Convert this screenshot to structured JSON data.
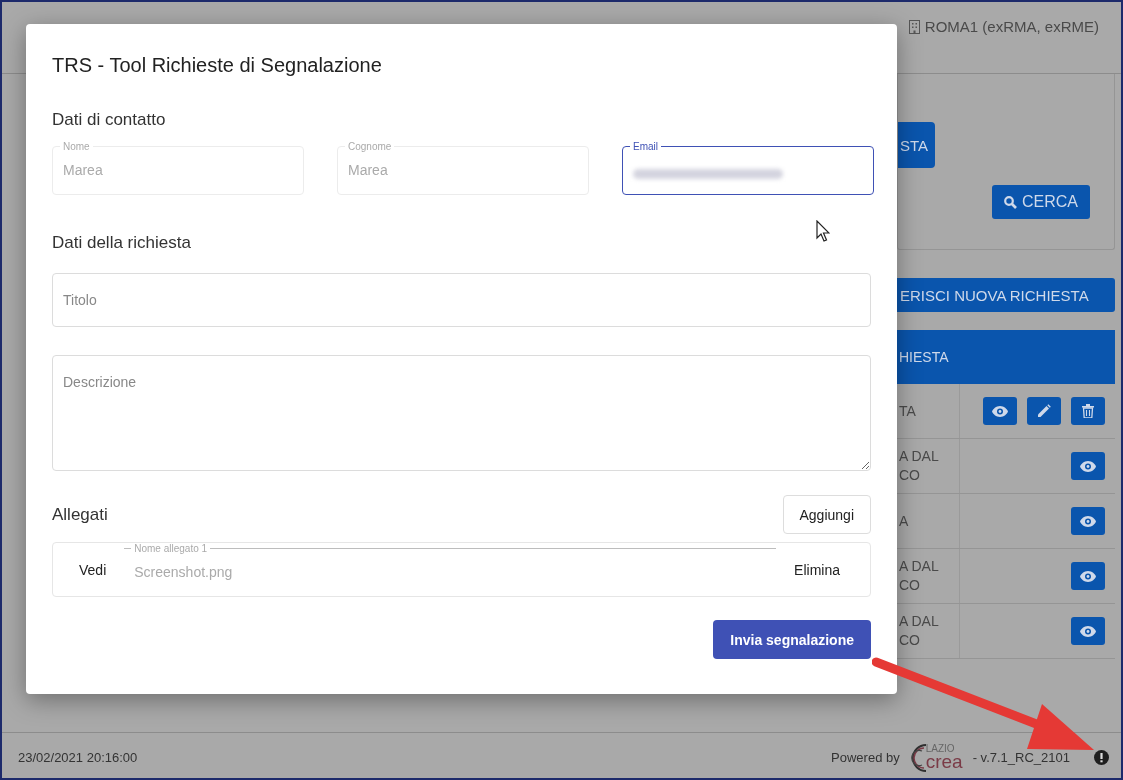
{
  "header": {
    "location": "ROMA1 (exRMA, exRME)"
  },
  "background": {
    "search_button": "CERCA",
    "partial_button": "STA",
    "new_request_button": "ERISCI NUOVA RICHIESTA",
    "table_header": "HIESTA",
    "rows": [
      {
        "status": "TA",
        "actions": [
          {
            "kind": "view"
          },
          {
            "kind": "edit"
          },
          {
            "kind": "delete"
          }
        ]
      },
      {
        "status": "A DAL\nCO",
        "actions": [
          {
            "kind": "view"
          }
        ]
      },
      {
        "status": "A",
        "actions": [
          {
            "kind": "view"
          }
        ]
      },
      {
        "status": "A DAL\nCO",
        "actions": [
          {
            "kind": "view"
          }
        ]
      },
      {
        "status": "A DAL\nCO",
        "actions": [
          {
            "kind": "view"
          }
        ]
      }
    ]
  },
  "dialog": {
    "title": "TRS - Tool Richieste di Segnalazione",
    "contact_heading": "Dati di contatto",
    "contact_fields": [
      {
        "label": "Nome",
        "value": "Marea",
        "disabled": true,
        "focused": false,
        "blurred": false
      },
      {
        "label": "Cognome",
        "value": "Marea",
        "disabled": true,
        "focused": false,
        "blurred": false
      },
      {
        "label": "Email",
        "disabled": false,
        "focused": true,
        "blurred": true
      }
    ],
    "request_heading": "Dati della richiesta",
    "title_field": {
      "placeholder": "Titolo"
    },
    "description_field": {
      "placeholder": "Descrizione"
    },
    "attachments_heading": "Allegati",
    "add_button": "Aggiungi",
    "attachments": [
      {
        "view": "Vedi",
        "label": "Nome allegato 1",
        "value": "Screenshot.png",
        "delete": "Elimina"
      }
    ],
    "submit_button": "Invia segnalazione"
  },
  "footer": {
    "datetime": "23/02/2021 20:16:00",
    "powered_by": "Powered by",
    "logo_top": "LAZIO",
    "logo_bottom": "crea",
    "version": "- v.7.1_RC_2101"
  }
}
